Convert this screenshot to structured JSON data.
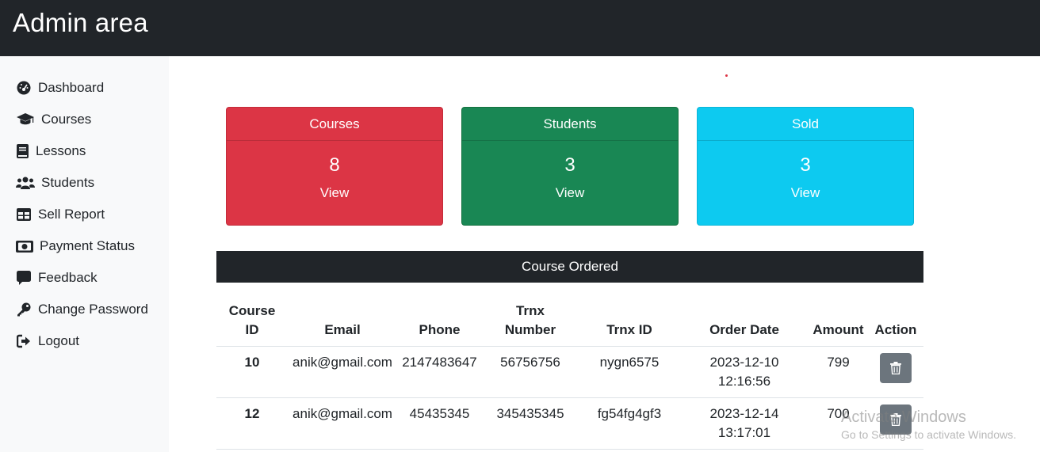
{
  "header": {
    "title": "Admin area"
  },
  "sidebar": {
    "items": [
      {
        "label": "Dashboard",
        "icon": "dashboard-gauge-icon"
      },
      {
        "label": "Courses",
        "icon": "graduation-cap-icon"
      },
      {
        "label": "Lessons",
        "icon": "book-icon"
      },
      {
        "label": "Students",
        "icon": "users-icon"
      },
      {
        "label": "Sell Report",
        "icon": "table-icon"
      },
      {
        "label": "Payment Status",
        "icon": "money-bill-icon"
      },
      {
        "label": "Feedback",
        "icon": "comment-icon"
      },
      {
        "label": "Change Password",
        "icon": "key-icon"
      },
      {
        "label": "Logout",
        "icon": "sign-out-icon"
      }
    ]
  },
  "cards": [
    {
      "title": "Courses",
      "value": "8",
      "link": "View",
      "color": "#dc3545"
    },
    {
      "title": "Students",
      "value": "3",
      "link": "View",
      "color": "#198754"
    },
    {
      "title": "Sold",
      "value": "3",
      "link": "View",
      "color": "#0dcaf0"
    }
  ],
  "section": {
    "title": "Course Ordered"
  },
  "table": {
    "headers": {
      "course_id_l1": "Course",
      "course_id_l2": "ID",
      "email": "Email",
      "phone": "Phone",
      "trnx_number_l1": "Trnx",
      "trnx_number_l2": "Number",
      "trnx_id": "Trnx ID",
      "order_date": "Order Date",
      "amount": "Amount",
      "action": "Action"
    },
    "rows": [
      {
        "course_id": "10",
        "email": "anik@gmail.com",
        "phone": "2147483647",
        "trnx_number": "56756756",
        "trnx_id": "nygn6575",
        "date": "2023-12-10",
        "time": "12:16:56",
        "amount": "799",
        "action_icon": "trash-icon"
      },
      {
        "course_id": "12",
        "email": "anik@gmail.com",
        "phone": "45435345",
        "trnx_number": "345435345",
        "trnx_id": "fg54fg4gf3",
        "date": "2023-12-14",
        "time": "13:17:01",
        "amount": "700",
        "action_icon": "trash-icon"
      }
    ]
  },
  "watermark": {
    "title": "Activate Windows",
    "subtitle": "Go to Settings to activate Windows."
  },
  "colors": {
    "topbar": "#212529",
    "sidebar": "#f8f9fa",
    "danger": "#dc3545",
    "success": "#198754",
    "info": "#0dcaf0",
    "secondary": "#6c757d"
  }
}
